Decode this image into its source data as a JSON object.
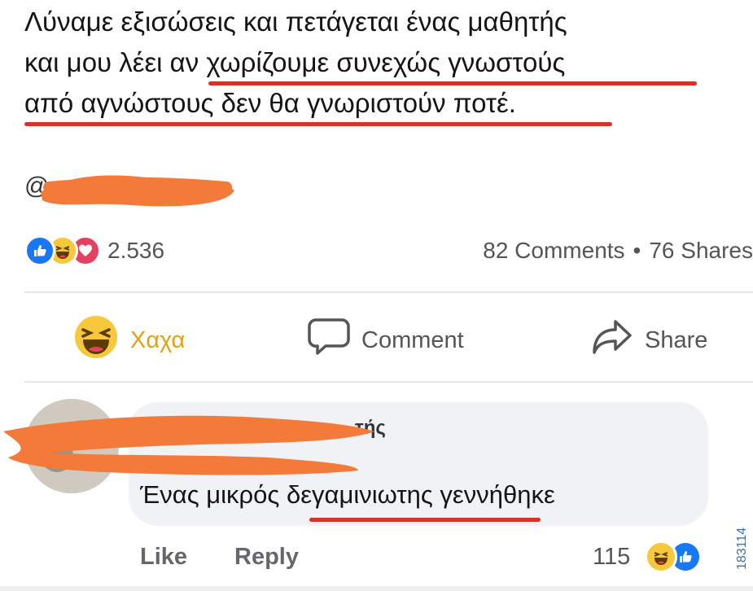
{
  "post": {
    "text_lines": [
      "Λύναμε εξισώσεις και πετάγεται ένας μαθητής",
      "και μου λέει αν χωρίζουμε συνεχώς γνωστούς",
      "από αγνώστους δεν θα γνωριστούν ποτέ."
    ],
    "mention_prefix": "@",
    "accent_color": "#d6322a",
    "scribble_color": "#f47a3a"
  },
  "reactions": {
    "icons": [
      "like-icon",
      "haha-icon",
      "love-icon"
    ],
    "count": "2.536"
  },
  "stats": {
    "comments": "82 Comments",
    "separator": "•",
    "shares": "76 Shares"
  },
  "actions": {
    "reaction_label": "Χαχα",
    "comment_label": "Comment",
    "share_label": "Share"
  },
  "comment": {
    "name_fragment": "τής",
    "text": "Ένας μικρός δεγαμινιωτης γεννήθηκε",
    "like_label": "Like",
    "reply_label": "Reply",
    "reaction_count": "115",
    "reaction_icons": [
      "haha-icon",
      "like-icon"
    ]
  },
  "watermark": "183114"
}
